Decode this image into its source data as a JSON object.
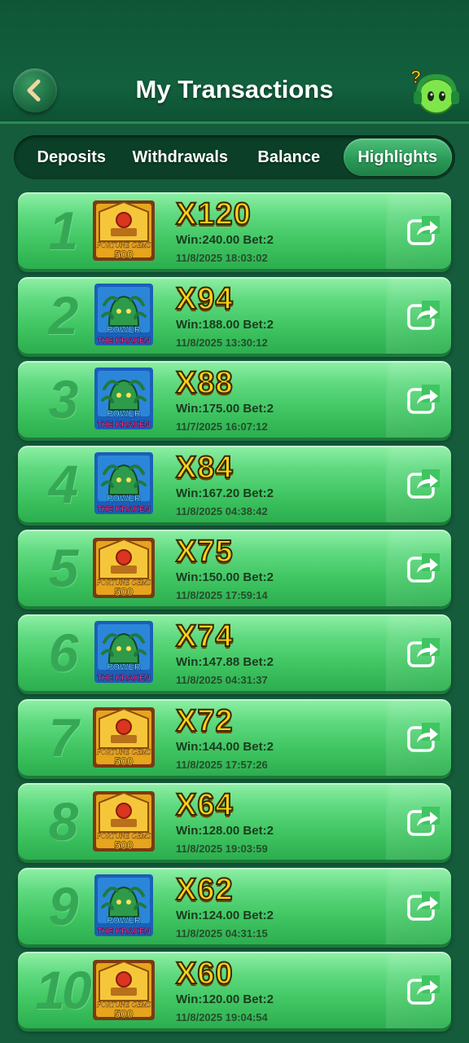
{
  "header": {
    "title": "My Transactions",
    "back_icon": "back-arrow-icon",
    "help_icon": "support-mascot-icon"
  },
  "tabs": [
    {
      "label": "Deposits",
      "active": false
    },
    {
      "label": "Withdrawals",
      "active": false
    },
    {
      "label": "Balance",
      "active": false
    },
    {
      "label": "Highlights",
      "active": true
    }
  ],
  "highlights": [
    {
      "rank": "1",
      "game": "fortune-gems-500",
      "multiplier": "X120",
      "winbet": "Win:240.00 Bet:2",
      "date": "11/8/2025 18:03:02"
    },
    {
      "rank": "2",
      "game": "power-of-the-kraken",
      "multiplier": "X94",
      "winbet": "Win:188.00 Bet:2",
      "date": "11/8/2025 13:30:12"
    },
    {
      "rank": "3",
      "game": "power-of-the-kraken",
      "multiplier": "X88",
      "winbet": "Win:175.00 Bet:2",
      "date": "11/7/2025 16:07:12"
    },
    {
      "rank": "4",
      "game": "power-of-the-kraken",
      "multiplier": "X84",
      "winbet": "Win:167.20 Bet:2",
      "date": "11/8/2025 04:38:42"
    },
    {
      "rank": "5",
      "game": "fortune-gems-500",
      "multiplier": "X75",
      "winbet": "Win:150.00 Bet:2",
      "date": "11/8/2025 17:59:14"
    },
    {
      "rank": "6",
      "game": "power-of-the-kraken",
      "multiplier": "X74",
      "winbet": "Win:147.88 Bet:2",
      "date": "11/8/2025 04:31:37"
    },
    {
      "rank": "7",
      "game": "fortune-gems-500",
      "multiplier": "X72",
      "winbet": "Win:144.00 Bet:2",
      "date": "11/8/2025 17:57:26"
    },
    {
      "rank": "8",
      "game": "fortune-gems-500",
      "multiplier": "X64",
      "winbet": "Win:128.00 Bet:2",
      "date": "11/8/2025 19:03:59"
    },
    {
      "rank": "9",
      "game": "power-of-the-kraken",
      "multiplier": "X62",
      "winbet": "Win:124.00 Bet:2",
      "date": "11/8/2025 04:31:15"
    },
    {
      "rank": "10",
      "game": "fortune-gems-500",
      "multiplier": "X60",
      "winbet": "Win:120.00 Bet:2",
      "date": "11/8/2025 19:04:54"
    }
  ],
  "game_logos": {
    "fortune-gems-500": {
      "line1": "FORTUNE GEMS",
      "line2": "500"
    },
    "power-of-the-kraken": {
      "line1": "POWER",
      "line2": "THE KRAKEN"
    }
  },
  "colors": {
    "background": "#145c3c",
    "row_green": "#3fc561",
    "multiplier_gold": "#ffd21a",
    "active_tab": "#2a9a58"
  }
}
